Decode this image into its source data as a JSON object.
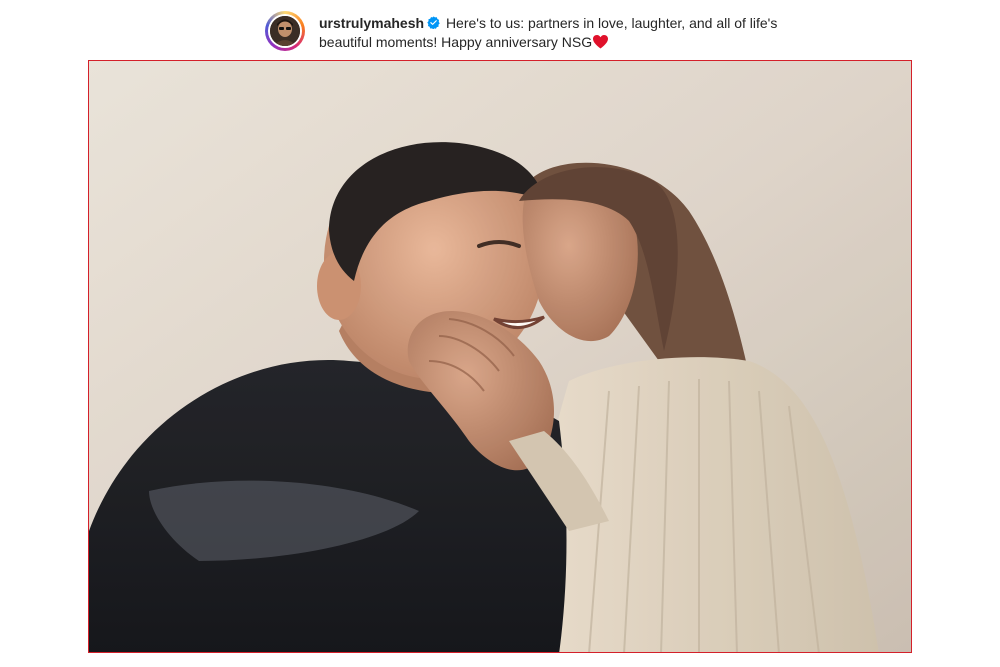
{
  "post": {
    "username": "urstrulymahesh",
    "verified": true,
    "caption_text": "Here's to us: partners in love, laughter, and all of life's beautiful moments! Happy anniversary NSG",
    "caption_emoji_icon": "red-heart-icon"
  },
  "image": {
    "description_icon": "photo-image",
    "frame_border_color": "#d4202a"
  },
  "colors": {
    "verified_blue": "#0095f6",
    "heart_red": "#e0112b",
    "text": "#262626"
  }
}
